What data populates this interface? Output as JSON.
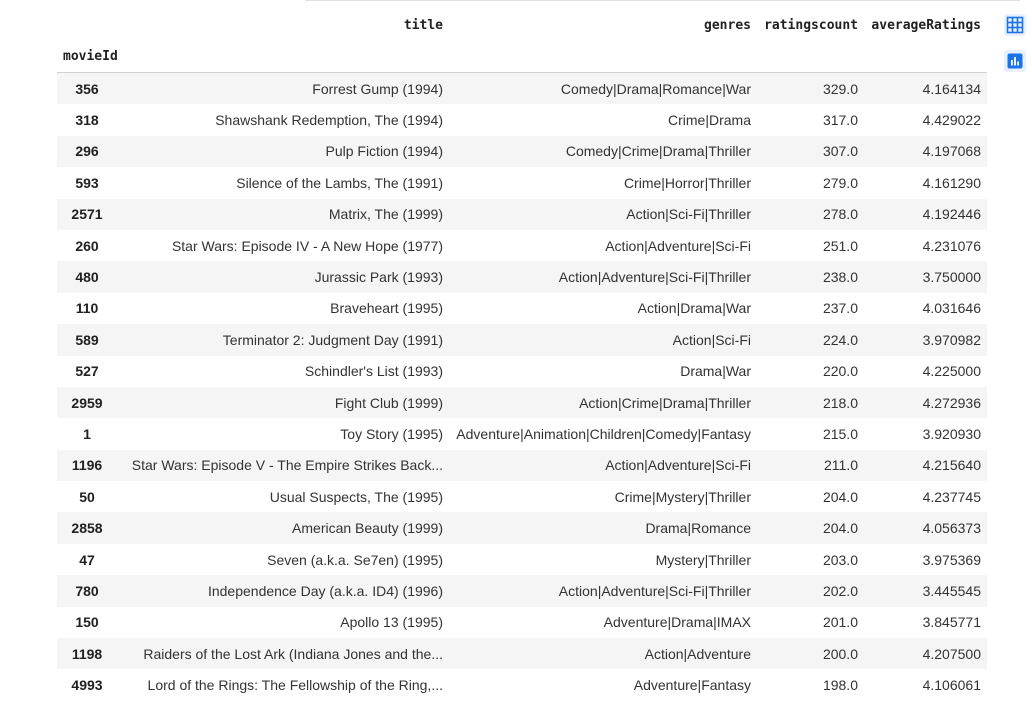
{
  "table": {
    "columns": [
      "title",
      "genres",
      "ratingscount",
      "averageRatings"
    ],
    "index_name": "movieId",
    "rows": [
      {
        "id": "356",
        "title": "Forrest Gump (1994)",
        "genres": "Comedy|Drama|Romance|War",
        "ratingscount": "329.0",
        "averageRatings": "4.164134"
      },
      {
        "id": "318",
        "title": "Shawshank Redemption, The (1994)",
        "genres": "Crime|Drama",
        "ratingscount": "317.0",
        "averageRatings": "4.429022"
      },
      {
        "id": "296",
        "title": "Pulp Fiction (1994)",
        "genres": "Comedy|Crime|Drama|Thriller",
        "ratingscount": "307.0",
        "averageRatings": "4.197068"
      },
      {
        "id": "593",
        "title": "Silence of the Lambs, The (1991)",
        "genres": "Crime|Horror|Thriller",
        "ratingscount": "279.0",
        "averageRatings": "4.161290"
      },
      {
        "id": "2571",
        "title": "Matrix, The (1999)",
        "genres": "Action|Sci-Fi|Thriller",
        "ratingscount": "278.0",
        "averageRatings": "4.192446"
      },
      {
        "id": "260",
        "title": "Star Wars: Episode IV - A New Hope (1977)",
        "genres": "Action|Adventure|Sci-Fi",
        "ratingscount": "251.0",
        "averageRatings": "4.231076"
      },
      {
        "id": "480",
        "title": "Jurassic Park (1993)",
        "genres": "Action|Adventure|Sci-Fi|Thriller",
        "ratingscount": "238.0",
        "averageRatings": "3.750000"
      },
      {
        "id": "110",
        "title": "Braveheart (1995)",
        "genres": "Action|Drama|War",
        "ratingscount": "237.0",
        "averageRatings": "4.031646"
      },
      {
        "id": "589",
        "title": "Terminator 2: Judgment Day (1991)",
        "genres": "Action|Sci-Fi",
        "ratingscount": "224.0",
        "averageRatings": "3.970982"
      },
      {
        "id": "527",
        "title": "Schindler's List (1993)",
        "genres": "Drama|War",
        "ratingscount": "220.0",
        "averageRatings": "4.225000"
      },
      {
        "id": "2959",
        "title": "Fight Club (1999)",
        "genres": "Action|Crime|Drama|Thriller",
        "ratingscount": "218.0",
        "averageRatings": "4.272936"
      },
      {
        "id": "1",
        "title": "Toy Story (1995)",
        "genres": "Adventure|Animation|Children|Comedy|Fantasy",
        "ratingscount": "215.0",
        "averageRatings": "3.920930"
      },
      {
        "id": "1196",
        "title": "Star Wars: Episode V - The Empire Strikes Back...",
        "genres": "Action|Adventure|Sci-Fi",
        "ratingscount": "211.0",
        "averageRatings": "4.215640"
      },
      {
        "id": "50",
        "title": "Usual Suspects, The (1995)",
        "genres": "Crime|Mystery|Thriller",
        "ratingscount": "204.0",
        "averageRatings": "4.237745"
      },
      {
        "id": "2858",
        "title": "American Beauty (1999)",
        "genres": "Drama|Romance",
        "ratingscount": "204.0",
        "averageRatings": "4.056373"
      },
      {
        "id": "47",
        "title": "Seven (a.k.a. Se7en) (1995)",
        "genres": "Mystery|Thriller",
        "ratingscount": "203.0",
        "averageRatings": "3.975369"
      },
      {
        "id": "780",
        "title": "Independence Day (a.k.a. ID4) (1996)",
        "genres": "Action|Adventure|Sci-Fi|Thriller",
        "ratingscount": "202.0",
        "averageRatings": "3.445545"
      },
      {
        "id": "150",
        "title": "Apollo 13 (1995)",
        "genres": "Adventure|Drama|IMAX",
        "ratingscount": "201.0",
        "averageRatings": "3.845771"
      },
      {
        "id": "1198",
        "title": "Raiders of the Lost Ark (Indiana Jones and the...",
        "genres": "Action|Adventure",
        "ratingscount": "200.0",
        "averageRatings": "4.207500"
      },
      {
        "id": "4993",
        "title": "Lord of the Rings: The Fellowship of the Ring,...",
        "genres": "Adventure|Fantasy",
        "ratingscount": "198.0",
        "averageRatings": "4.106061"
      }
    ]
  },
  "side_buttons": [
    {
      "icon": "table-icon",
      "color": "#1a73e8"
    },
    {
      "icon": "bar-chart-icon",
      "color": "#1a73e8"
    }
  ],
  "colors": {
    "stripe": "#f5f5f5",
    "accent": "#1a73e8"
  }
}
